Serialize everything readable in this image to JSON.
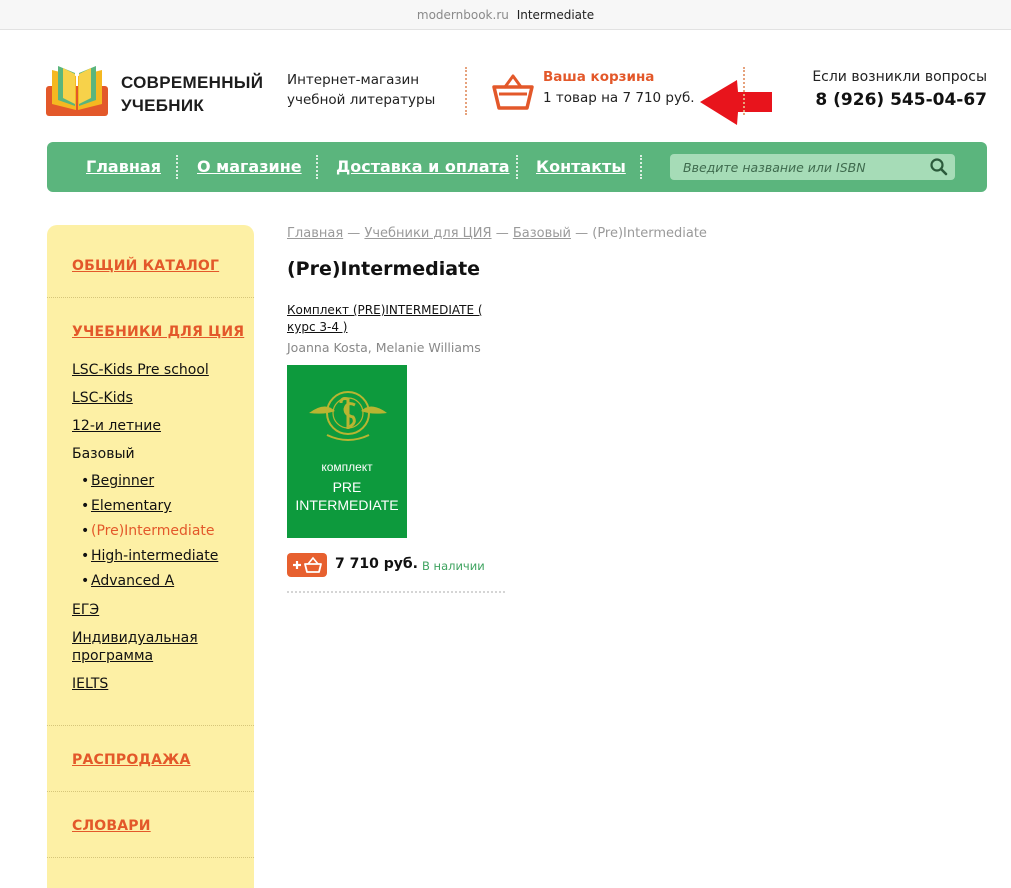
{
  "browser": {
    "domain": "modernbook.ru",
    "page_title": "Intermediate"
  },
  "header": {
    "logo_line1": "СОВРЕМЕННЫЙ",
    "logo_line2": "УЧЕБНИК",
    "tagline_line1": "Интернет-магазин",
    "tagline_line2": "учебной литературы",
    "cart_title": "Ваша корзина",
    "cart_info": "1 товар на 7 710 руб.",
    "contact_question": "Если возникли вопросы",
    "phone": "8 (926) 545-04-67"
  },
  "nav": {
    "items": [
      "Главная",
      "О магазине",
      "Доставка и оплата",
      "Контакты"
    ],
    "search_placeholder": "Введите название или ISBN"
  },
  "sidebar": {
    "catalog": "ОБЩИЙ КАТАЛОГ",
    "textbooks": "УЧЕБНИКИ ДЛЯ ЦИЯ",
    "links": [
      "LSC-Kids Pre school",
      "LSC-Kids",
      "12-и летние"
    ],
    "basic": "Базовый",
    "sub": [
      "Beginner",
      "Elementary",
      "(Pre)Intermediate",
      "High-intermediate",
      "Advanced A"
    ],
    "more": [
      "ЕГЭ",
      "Индивидуальная программа",
      "IELTS"
    ],
    "sale": "РАСПРОДАЖА",
    "dictionaries": "СЛОВАРИ"
  },
  "breadcrumb": {
    "items": [
      "Главная",
      "Учебники для ЦИЯ",
      "Базовый"
    ],
    "current": "(Pre)Intermediate",
    "sep": "—"
  },
  "main": {
    "title": "(Pre)Intermediate",
    "product": {
      "name": "Комплект (PRE)INTERMEDIATE ( курс 3-4 )",
      "authors": "Joanna Kosta, Melanie Williams",
      "cover_line1": "комплект",
      "cover_line2": "PRE",
      "cover_line3": "INTERMEDIATE",
      "price": "7 710 руб.",
      "availability": "В наличии"
    }
  },
  "colors": {
    "accent_orange": "#e3582a",
    "nav_green": "#5bb57d",
    "sidebar_yellow": "#fdf0a5",
    "cover_green": "#0d9a3d",
    "arrow_red": "#e8141c"
  }
}
